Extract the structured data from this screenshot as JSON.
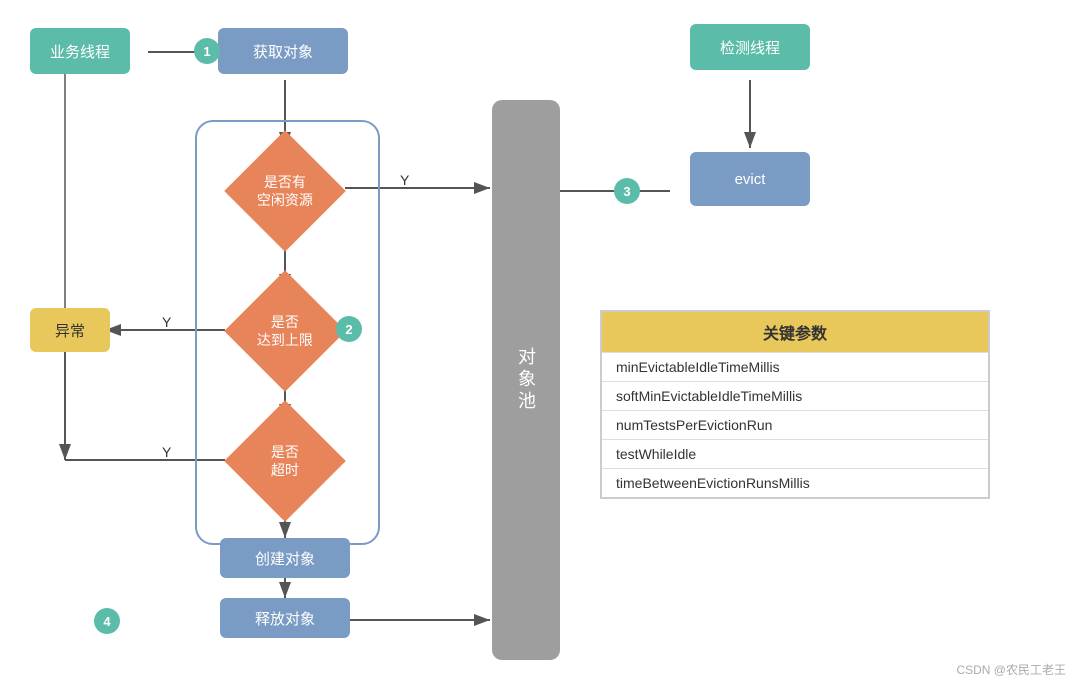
{
  "nodes": {
    "business_thread": {
      "label": "业务线程"
    },
    "get_object": {
      "label": "获取对象"
    },
    "check_idle": {
      "label": "是否有\n空闲资源"
    },
    "check_limit": {
      "label": "是否\n达到上限"
    },
    "check_timeout": {
      "label": "是否\n超时"
    },
    "create_object": {
      "label": "创建对象"
    },
    "release_object": {
      "label": "释放对象"
    },
    "exception": {
      "label": "异常"
    },
    "object_pool": {
      "label": "对象池"
    },
    "detect_thread": {
      "label": "检测线程"
    },
    "evict": {
      "label": "evict"
    }
  },
  "badges": {
    "b1": "1",
    "b2": "2",
    "b3": "3",
    "b4": "4"
  },
  "labels": {
    "y1": "Y",
    "y2": "Y",
    "y3": "Y"
  },
  "params": {
    "title": "关键参数",
    "rows": [
      "minEvictableIdleTimeMillis",
      "softMinEvictableIdleTimeMillis",
      "numTestsPerEvictionRun",
      "testWhileIdle",
      "timeBetweenEvictionRunsMillis"
    ]
  },
  "watermark": "CSDN @农民工老王"
}
